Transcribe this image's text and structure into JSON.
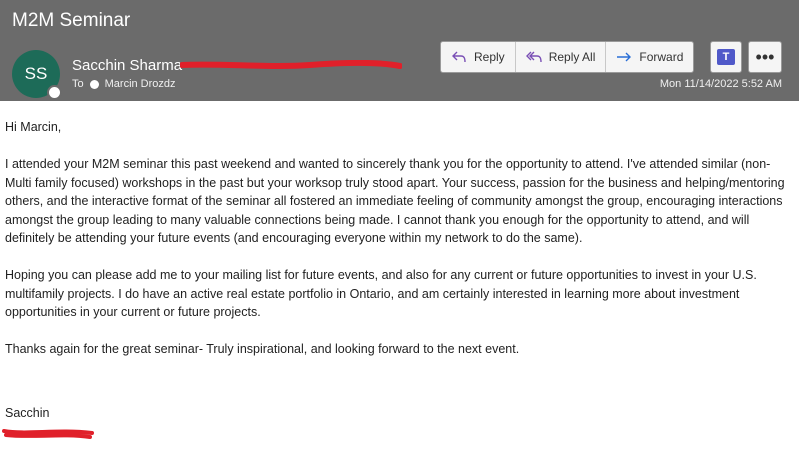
{
  "email": {
    "subject": "M2M Seminar",
    "avatar_initials": "SS",
    "sender_name": "Sacchin Sharma",
    "to_label": "To",
    "recipient": "Marcin Drozdz",
    "timestamp": "Mon 11/14/2022 5:52 AM"
  },
  "actions": {
    "reply": "Reply",
    "reply_all": "Reply All",
    "forward": "Forward",
    "teams_icon": "T",
    "more": "•••"
  },
  "body": {
    "greeting": "Hi Marcin,",
    "paragraph1": "I attended your M2M seminar this past weekend and wanted to sincerely thank you for the opportunity to attend.  I've attended similar (non-Multi family focused) workshops in the past but your worksop truly stood apart. Your success, passion for the business and helping/mentoring others, and the interactive format of the seminar all  fostered an immediate feeling of community amongst the group, encouraging interactions amongst the group leading to many valuable connections being made. I cannot thank you enough for the opportunity to attend, and will definitely be attending your future events (and encouraging everyone within my network to do the same).",
    "paragraph2": "Hoping you can please add me to your mailing list for future events, and also for any current or future opportunities to invest in your U.S. multifamily projects. I do have an active real estate portfolio in Ontario, and am certainly interested in learning more about investment opportunities in your current or future projects.",
    "paragraph3": "Thanks again for the great seminar- Truly inspirational, and looking forward to the next event.",
    "signature": "Sacchin"
  },
  "colors": {
    "header_bg": "#6b6b6b",
    "avatar_bg": "#1d6b58",
    "redaction": "#e0202a",
    "icon_purple": "#7a4fb5",
    "icon_blue": "#2a6fd6",
    "teams": "#5059c9"
  },
  "icons": [
    "reply-icon",
    "reply-all-icon",
    "forward-icon",
    "teams-icon",
    "more-icon"
  ]
}
